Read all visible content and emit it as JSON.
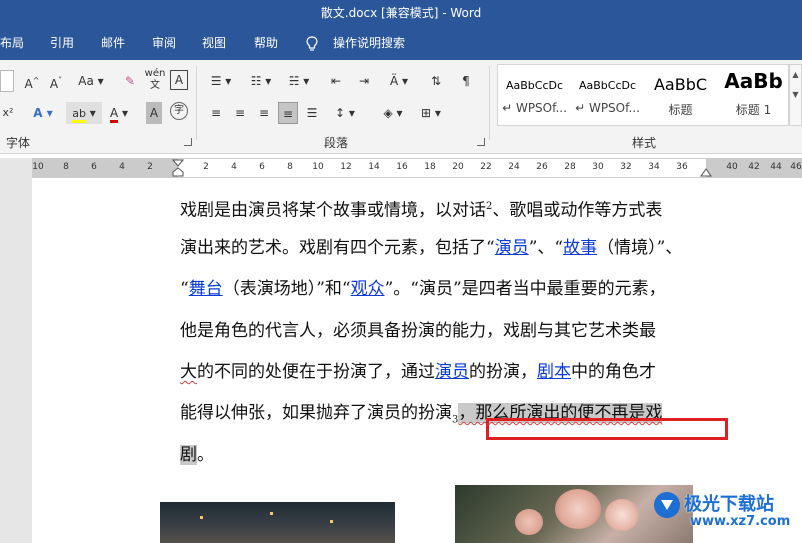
{
  "window": {
    "title": "散文.docx [兼容模式]  -  Word"
  },
  "menu": {
    "items": [
      "布局",
      "引用",
      "邮件",
      "审阅",
      "视图",
      "帮助"
    ],
    "tell_me": "操作说明搜索"
  },
  "ribbon": {
    "font_row1": [
      "A^",
      "A˅",
      "Aa",
      "wén",
      "A"
    ],
    "font_row2": [
      "x²",
      "A",
      "ab",
      "A",
      "A",
      "字"
    ],
    "groups": {
      "font": "字体",
      "paragraph": "段落",
      "styles": "样式"
    },
    "styles": [
      {
        "sample": "AaBbCcDc",
        "name": "↵ WPSOf..."
      },
      {
        "sample": "AaBbCcDc",
        "name": "↵ WPSOf..."
      },
      {
        "sample": "AaBbC",
        "name": "标题"
      },
      {
        "sample": "AaBb",
        "name": "标题 1"
      }
    ]
  },
  "ruler": {
    "left_ticks": [
      "10",
      "8",
      "6",
      "4",
      "2"
    ],
    "right_ticks": [
      "2",
      "4",
      "6",
      "8",
      "10",
      "12",
      "14",
      "16",
      "18",
      "20",
      "22",
      "24",
      "26",
      "28",
      "30",
      "32",
      "34",
      "36",
      "40",
      "42",
      "44",
      "46"
    ]
  },
  "document": {
    "line1_a": "戏剧是由演员将某个故事或情境，以对话",
    "line1_sup": "2",
    "line1_b": "、歌唱或动作等方式表",
    "line2_a": "演出来的艺术。戏剧有四个元素，包括了“",
    "line2_link1": "演员",
    "line2_b": "”、“",
    "line2_link2": "故事",
    "line2_c": "（情境）”、",
    "line3_a": "“",
    "line3_link1": "舞台",
    "line3_b": "（表演场地）”和“",
    "line3_link2": "观众",
    "line3_c": "”。“演员”是四者当中最重要的元素，",
    "line4": "他是角色的代言人，必须具备扮演的能力，戏剧与其它艺术类最",
    "line5_a": "大",
    "line5_b": "的不同的处便在于扮演了，通过",
    "line5_link1": "演员",
    "line5_c": "的扮演，",
    "line5_link2": "剧本",
    "line5_d": "中的角色才",
    "line6_a": "能得以伸张，如果抛弃了演员的扮演",
    "line6_sub": "3",
    "line6_hl": "，那么所演出的便不再是戏",
    "line7_hl": "剧",
    "line7_end": "。"
  },
  "watermark": {
    "text": "极光下载站",
    "url": "www.xz7.com"
  },
  "colors": {
    "title_bar": "#2b579a",
    "link": "#0a3ad6",
    "highlight": "#c9c9c9",
    "red_box": "#e02020"
  }
}
